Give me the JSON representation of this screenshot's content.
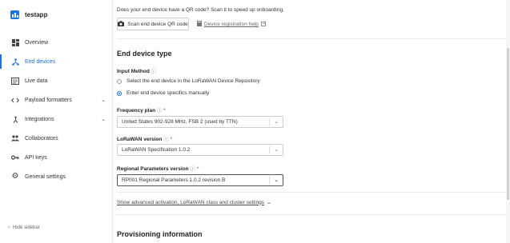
{
  "sidebar": {
    "app_name": "testapp",
    "items": [
      {
        "label": "Overview",
        "icon": "grid-icon"
      },
      {
        "label": "End devices",
        "icon": "network-icon",
        "active": true
      },
      {
        "label": "Live data",
        "icon": "list-icon"
      },
      {
        "label": "Payload formatters",
        "icon": "code-icon",
        "chevron": true
      },
      {
        "label": "Integrations",
        "icon": "integrations-icon",
        "chevron": true
      },
      {
        "label": "Collaborators",
        "icon": "people-icon"
      },
      {
        "label": "API keys",
        "icon": "key-icon"
      },
      {
        "label": "General settings",
        "icon": "gear-icon"
      }
    ],
    "hide_label": "Hide sidebar"
  },
  "onboarding": {
    "text": "Does your end device have a QR code? Scan it to speed up onboarding.",
    "scan_button": "Scan end device QR code",
    "help_link": "Device registration help"
  },
  "section": {
    "title": "End device type",
    "input_method_label": "Input Method",
    "radio_repository": "Select the end device in the LoRaWAN Device Repository",
    "radio_manual": "Enter end device specifics manually",
    "frequency_label": "Frequency plan",
    "frequency_value": "United States 902-928 MHz, FSB 2 (used by TTN)",
    "lorawan_label": "LoRaWAN version",
    "lorawan_value": "LoRaWAN Specification 1.0.2",
    "regional_label": "Regional Parameters version",
    "regional_value": "RP001 Regional Parameters 1.0.2 revision B",
    "advanced_link": "Show advanced activation, LoRaWAN class and cluster settings"
  },
  "provisioning": {
    "title": "Provisioning information"
  },
  "colors": {
    "accent": "#1a73e8",
    "required": "#d93025"
  }
}
